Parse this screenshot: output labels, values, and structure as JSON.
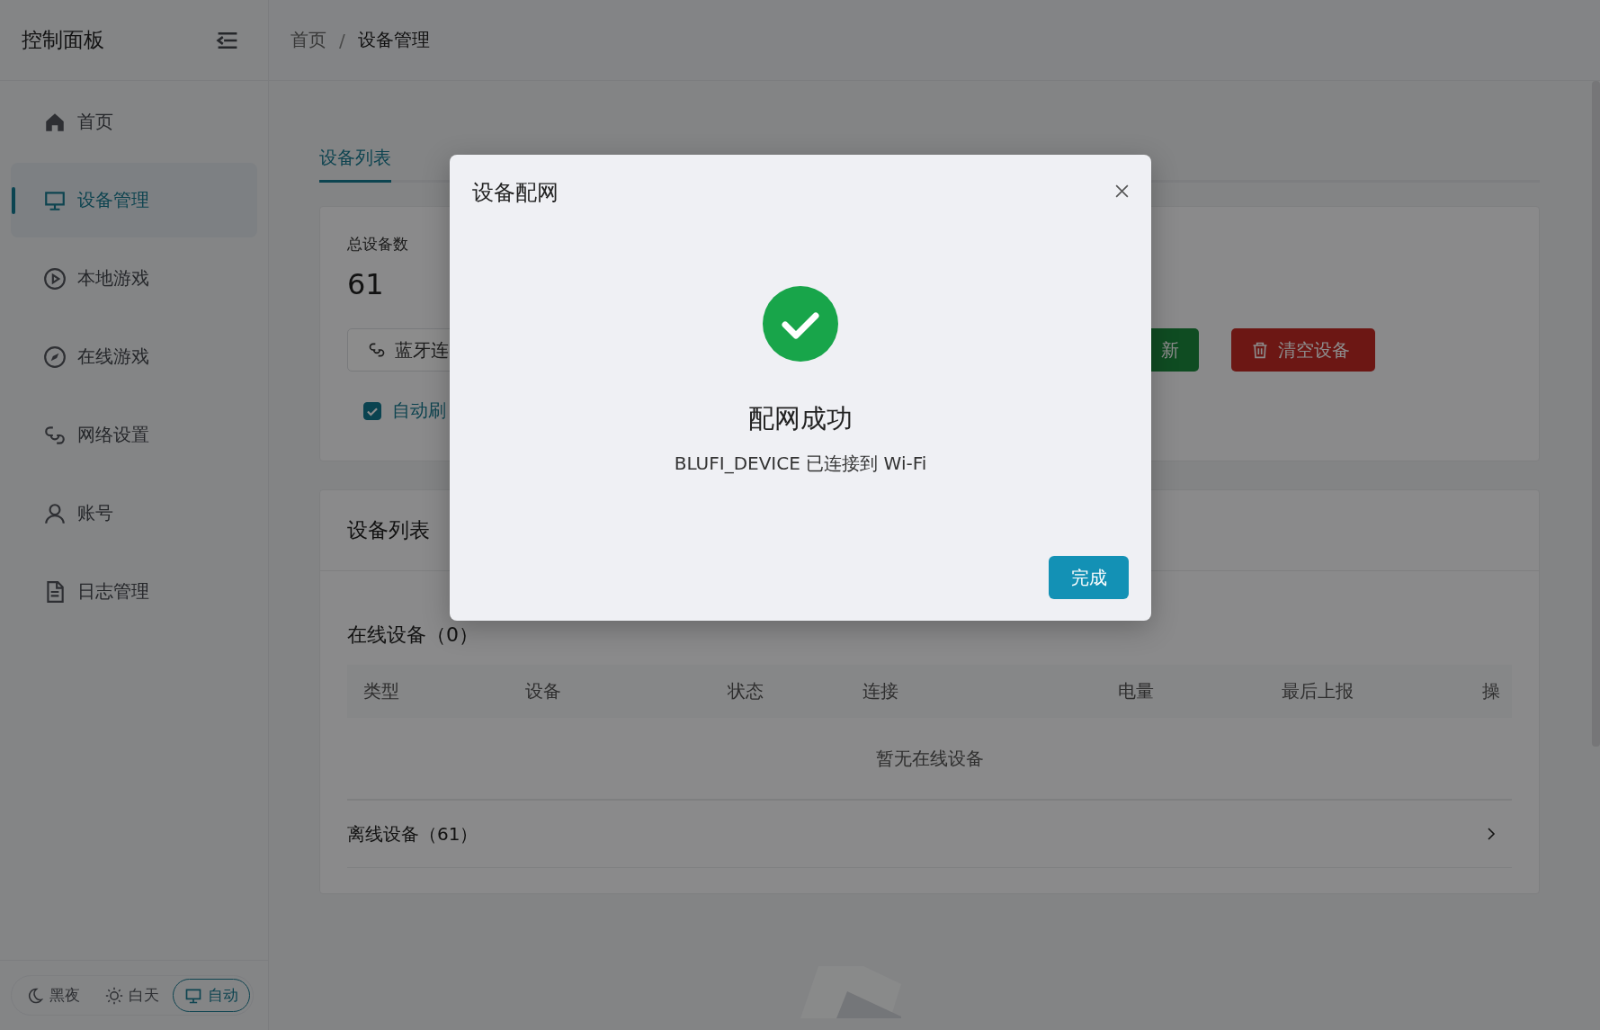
{
  "sidebar": {
    "title": "控制面板",
    "items": [
      {
        "label": "首页",
        "selected": false
      },
      {
        "label": "设备管理",
        "selected": true
      },
      {
        "label": "本地游戏",
        "selected": false
      },
      {
        "label": "在线游戏",
        "selected": false
      },
      {
        "label": "网络设置",
        "selected": false
      },
      {
        "label": "账号",
        "selected": false
      },
      {
        "label": "日志管理",
        "selected": false
      }
    ],
    "theme_switch": [
      {
        "label": "黑夜",
        "selected": false
      },
      {
        "label": "白天",
        "selected": false
      },
      {
        "label": "自动",
        "selected": true
      }
    ]
  },
  "breadcrumb": {
    "items": [
      "首页",
      "设备管理"
    ],
    "separator": "/"
  },
  "tabs": [
    {
      "label": "设备列表",
      "selected": true
    }
  ],
  "stats": {
    "label": "总设备数",
    "value": "61"
  },
  "actions": [
    {
      "label": "蓝牙连",
      "kind": "outline"
    },
    {
      "label": "新",
      "kind": "success"
    },
    {
      "label": "清空设备",
      "kind": "danger"
    }
  ],
  "auto_refresh": {
    "label": "自动刷",
    "checked": true
  },
  "device_list": {
    "title": "设备列表",
    "online_title": "在线设备（0）",
    "columns": [
      "类型",
      "设备",
      "状态",
      "连接",
      "电量",
      "最后上报",
      "操"
    ],
    "empty": "暂无在线设备",
    "offline_title": "离线设备（61）"
  },
  "dialog": {
    "title": "设备配网",
    "status": "配网成功",
    "message": "BLUFI_DEVICE 已连接到 Wi-Fi",
    "button": "完成"
  }
}
